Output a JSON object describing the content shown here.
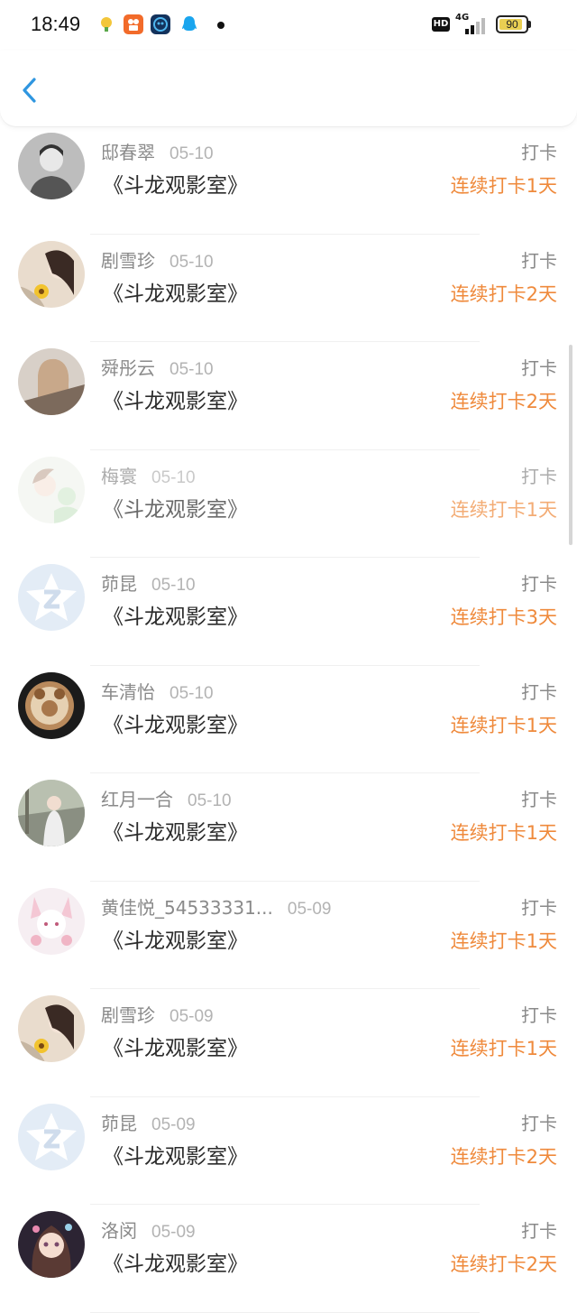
{
  "status_bar": {
    "time": "18:49",
    "network": "4G",
    "hd": "HD",
    "battery": "90",
    "battery_level": 0.9
  },
  "header": {
    "back_icon": "chevron-left-icon"
  },
  "items": [
    {
      "name": "邸春翠",
      "date": "05-10",
      "title": "《斗龙观影室》",
      "tag": "打卡",
      "streak": "连续打卡1天"
    },
    {
      "name": "剧雪珍",
      "date": "05-10",
      "title": "《斗龙观影室》",
      "tag": "打卡",
      "streak": "连续打卡2天"
    },
    {
      "name": "舜彤云",
      "date": "05-10",
      "title": "《斗龙观影室》",
      "tag": "打卡",
      "streak": "连续打卡2天"
    },
    {
      "name": "梅寰",
      "date": "05-10",
      "title": "《斗龙观影室》",
      "tag": "打卡",
      "streak": "连续打卡1天"
    },
    {
      "name": "茆昆",
      "date": "05-10",
      "title": "《斗龙观影室》",
      "tag": "打卡",
      "streak": "连续打卡3天"
    },
    {
      "name": "车清怡",
      "date": "05-10",
      "title": "《斗龙观影室》",
      "tag": "打卡",
      "streak": "连续打卡1天"
    },
    {
      "name": "红月一合",
      "date": "05-10",
      "title": "《斗龙观影室》",
      "tag": "打卡",
      "streak": "连续打卡1天"
    },
    {
      "name": "黄佳悦_54533331...",
      "date": "05-09",
      "title": "《斗龙观影室》",
      "tag": "打卡",
      "streak": "连续打卡1天"
    },
    {
      "name": "剧雪珍",
      "date": "05-09",
      "title": "《斗龙观影室》",
      "tag": "打卡",
      "streak": "连续打卡1天"
    },
    {
      "name": "茆昆",
      "date": "05-09",
      "title": "《斗龙观影室》",
      "tag": "打卡",
      "streak": "连续打卡2天"
    },
    {
      "name": "洛闵",
      "date": "05-09",
      "title": "《斗龙观影室》",
      "tag": "打卡",
      "streak": "连续打卡2天"
    }
  ],
  "colors": {
    "accent": "#ef8a3c",
    "back": "#2f96e0",
    "name": "#8a8a8a",
    "title": "#2b2b2b"
  }
}
